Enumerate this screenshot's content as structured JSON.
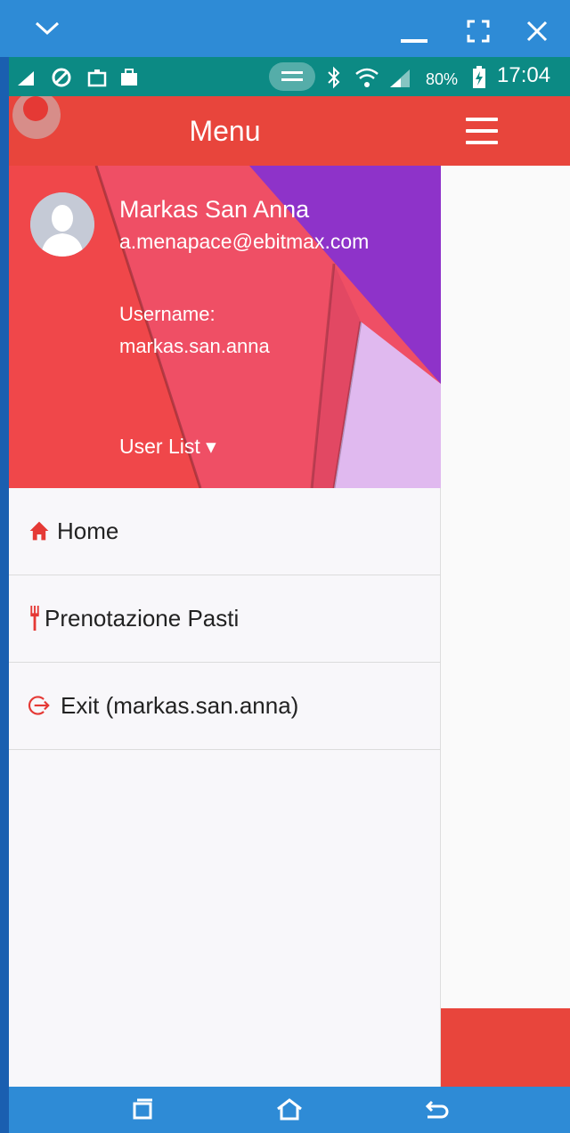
{
  "status": {
    "battery": "80%",
    "time": "17:04"
  },
  "drawer": {
    "title": "Menu",
    "user": {
      "name": "Markas San Anna",
      "email": "a.menapace@ebitmax.com",
      "username_label": "Username:",
      "username": "markas.san.anna",
      "user_list": "User List ▾"
    },
    "items": [
      {
        "label": "Home",
        "icon": "home-icon"
      },
      {
        "label": "Prenotazione Pasti",
        "icon": "fork-icon"
      },
      {
        "label": "Exit (markas.san.anna)",
        "icon": "exit-icon"
      }
    ]
  },
  "colors": {
    "accent": "#e8453c",
    "header_purple": "#8e33c9",
    "header_pink": "#ef4f65",
    "statusbar": "#0c8a84",
    "frame": "#2e8bd6"
  }
}
